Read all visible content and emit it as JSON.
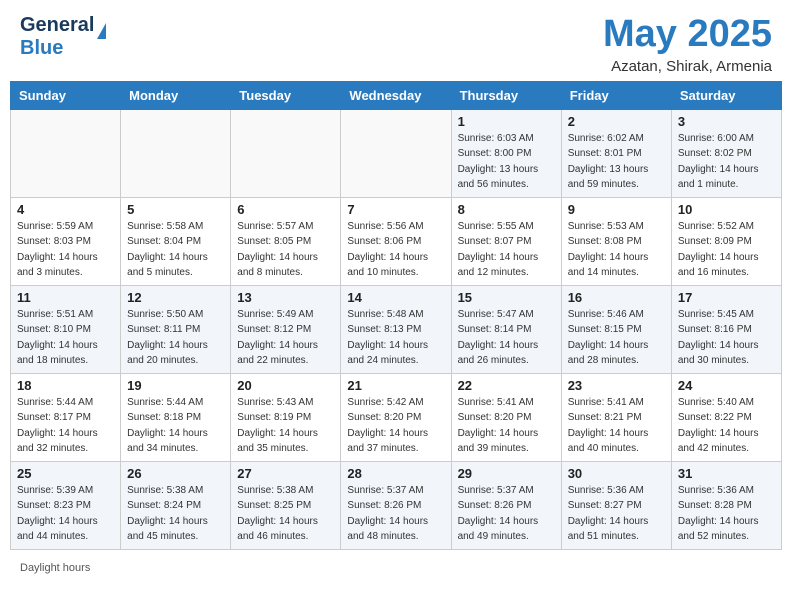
{
  "header": {
    "logo_line1": "General",
    "logo_line2": "Blue",
    "month_year": "May 2025",
    "location": "Azatan, Shirak, Armenia"
  },
  "days_of_week": [
    "Sunday",
    "Monday",
    "Tuesday",
    "Wednesday",
    "Thursday",
    "Friday",
    "Saturday"
  ],
  "weeks": [
    [
      {
        "day": "",
        "info": ""
      },
      {
        "day": "",
        "info": ""
      },
      {
        "day": "",
        "info": ""
      },
      {
        "day": "",
        "info": ""
      },
      {
        "day": "1",
        "info": "Sunrise: 6:03 AM\nSunset: 8:00 PM\nDaylight: 13 hours\nand 56 minutes."
      },
      {
        "day": "2",
        "info": "Sunrise: 6:02 AM\nSunset: 8:01 PM\nDaylight: 13 hours\nand 59 minutes."
      },
      {
        "day": "3",
        "info": "Sunrise: 6:00 AM\nSunset: 8:02 PM\nDaylight: 14 hours\nand 1 minute."
      }
    ],
    [
      {
        "day": "4",
        "info": "Sunrise: 5:59 AM\nSunset: 8:03 PM\nDaylight: 14 hours\nand 3 minutes."
      },
      {
        "day": "5",
        "info": "Sunrise: 5:58 AM\nSunset: 8:04 PM\nDaylight: 14 hours\nand 5 minutes."
      },
      {
        "day": "6",
        "info": "Sunrise: 5:57 AM\nSunset: 8:05 PM\nDaylight: 14 hours\nand 8 minutes."
      },
      {
        "day": "7",
        "info": "Sunrise: 5:56 AM\nSunset: 8:06 PM\nDaylight: 14 hours\nand 10 minutes."
      },
      {
        "day": "8",
        "info": "Sunrise: 5:55 AM\nSunset: 8:07 PM\nDaylight: 14 hours\nand 12 minutes."
      },
      {
        "day": "9",
        "info": "Sunrise: 5:53 AM\nSunset: 8:08 PM\nDaylight: 14 hours\nand 14 minutes."
      },
      {
        "day": "10",
        "info": "Sunrise: 5:52 AM\nSunset: 8:09 PM\nDaylight: 14 hours\nand 16 minutes."
      }
    ],
    [
      {
        "day": "11",
        "info": "Sunrise: 5:51 AM\nSunset: 8:10 PM\nDaylight: 14 hours\nand 18 minutes."
      },
      {
        "day": "12",
        "info": "Sunrise: 5:50 AM\nSunset: 8:11 PM\nDaylight: 14 hours\nand 20 minutes."
      },
      {
        "day": "13",
        "info": "Sunrise: 5:49 AM\nSunset: 8:12 PM\nDaylight: 14 hours\nand 22 minutes."
      },
      {
        "day": "14",
        "info": "Sunrise: 5:48 AM\nSunset: 8:13 PM\nDaylight: 14 hours\nand 24 minutes."
      },
      {
        "day": "15",
        "info": "Sunrise: 5:47 AM\nSunset: 8:14 PM\nDaylight: 14 hours\nand 26 minutes."
      },
      {
        "day": "16",
        "info": "Sunrise: 5:46 AM\nSunset: 8:15 PM\nDaylight: 14 hours\nand 28 minutes."
      },
      {
        "day": "17",
        "info": "Sunrise: 5:45 AM\nSunset: 8:16 PM\nDaylight: 14 hours\nand 30 minutes."
      }
    ],
    [
      {
        "day": "18",
        "info": "Sunrise: 5:44 AM\nSunset: 8:17 PM\nDaylight: 14 hours\nand 32 minutes."
      },
      {
        "day": "19",
        "info": "Sunrise: 5:44 AM\nSunset: 8:18 PM\nDaylight: 14 hours\nand 34 minutes."
      },
      {
        "day": "20",
        "info": "Sunrise: 5:43 AM\nSunset: 8:19 PM\nDaylight: 14 hours\nand 35 minutes."
      },
      {
        "day": "21",
        "info": "Sunrise: 5:42 AM\nSunset: 8:20 PM\nDaylight: 14 hours\nand 37 minutes."
      },
      {
        "day": "22",
        "info": "Sunrise: 5:41 AM\nSunset: 8:20 PM\nDaylight: 14 hours\nand 39 minutes."
      },
      {
        "day": "23",
        "info": "Sunrise: 5:41 AM\nSunset: 8:21 PM\nDaylight: 14 hours\nand 40 minutes."
      },
      {
        "day": "24",
        "info": "Sunrise: 5:40 AM\nSunset: 8:22 PM\nDaylight: 14 hours\nand 42 minutes."
      }
    ],
    [
      {
        "day": "25",
        "info": "Sunrise: 5:39 AM\nSunset: 8:23 PM\nDaylight: 14 hours\nand 44 minutes."
      },
      {
        "day": "26",
        "info": "Sunrise: 5:38 AM\nSunset: 8:24 PM\nDaylight: 14 hours\nand 45 minutes."
      },
      {
        "day": "27",
        "info": "Sunrise: 5:38 AM\nSunset: 8:25 PM\nDaylight: 14 hours\nand 46 minutes."
      },
      {
        "day": "28",
        "info": "Sunrise: 5:37 AM\nSunset: 8:26 PM\nDaylight: 14 hours\nand 48 minutes."
      },
      {
        "day": "29",
        "info": "Sunrise: 5:37 AM\nSunset: 8:26 PM\nDaylight: 14 hours\nand 49 minutes."
      },
      {
        "day": "30",
        "info": "Sunrise: 5:36 AM\nSunset: 8:27 PM\nDaylight: 14 hours\nand 51 minutes."
      },
      {
        "day": "31",
        "info": "Sunrise: 5:36 AM\nSunset: 8:28 PM\nDaylight: 14 hours\nand 52 minutes."
      }
    ]
  ],
  "footer": {
    "note": "Daylight hours"
  }
}
